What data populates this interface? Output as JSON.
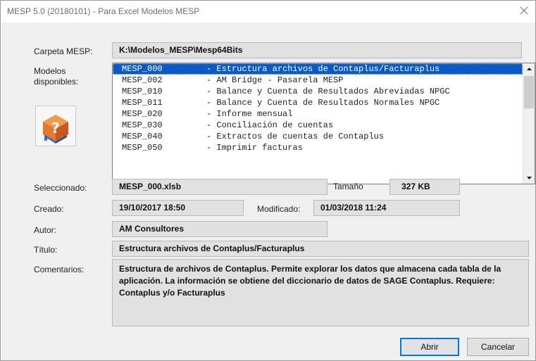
{
  "window": {
    "title": "MESP 5.0 (20180101) - Para Excel Modelos MESP"
  },
  "labels": {
    "carpeta": "Carpeta MESP:",
    "modelos_line1": "Modelos",
    "modelos_line2": "disponibles:",
    "seleccionado": "Seleccionado:",
    "tamano": "Tamaño",
    "creado": "Creado:",
    "modificado": "Modificado:",
    "autor": "Autor:",
    "titulo": "Título:",
    "comentarios": "Comentarios:"
  },
  "values": {
    "carpeta": "K:\\Modelos_MESP\\Mesp64Bits",
    "seleccionado": "MESP_000.xlsb",
    "tamano": "327 KB",
    "creado": "19/10/2017 18:50",
    "modificado": "01/03/2018 11:24",
    "autor": "AM Consultores",
    "titulo": "Estructura archivos de Contaplus/Facturaplus",
    "comentarios": "Estructura de archivos de  Contaplus. Permite explorar los datos que almacena cada tabla de la aplicación. La información se obtiene del diccionario de datos de SAGE Contaplus. Requiere: Contaplus y/o Facturaplus"
  },
  "models": [
    {
      "code": "MESP_000",
      "desc": "- Estructura archivos de Contaplus/Facturaplus",
      "selected": true
    },
    {
      "code": "MESP_002",
      "desc": "- AM Bridge - Pasarela MESP",
      "selected": false
    },
    {
      "code": "MESP_010",
      "desc": "- Balance y Cuenta de Resultados Abreviadas NPGC",
      "selected": false
    },
    {
      "code": "MESP_011",
      "desc": "- Balance y Cuenta de Resultados Normales NPGC",
      "selected": false
    },
    {
      "code": "MESP_020",
      "desc": "- Informe mensual",
      "selected": false
    },
    {
      "code": "MESP_030",
      "desc": "- Conciliación de cuentas",
      "selected": false
    },
    {
      "code": "MESP_040",
      "desc": "- Extractos de cuentas de Contaplus",
      "selected": false
    },
    {
      "code": "MESP_050",
      "desc": "- Imprimir facturas",
      "selected": false
    }
  ],
  "buttons": {
    "abrir": "Abrir",
    "cancelar": "Cancelar"
  },
  "icons": {
    "close": "close-icon",
    "help_book": "help-book-icon",
    "scroll_up": "scroll-up-arrow-icon",
    "scroll_down": "scroll-down-arrow-icon"
  },
  "colors": {
    "selection": "#0a59c9",
    "field_bg": "#e1e1e1",
    "dialog_bg": "#f0f0f0",
    "book_orange": "#e8772e",
    "book_blue": "#2f6fb6"
  }
}
